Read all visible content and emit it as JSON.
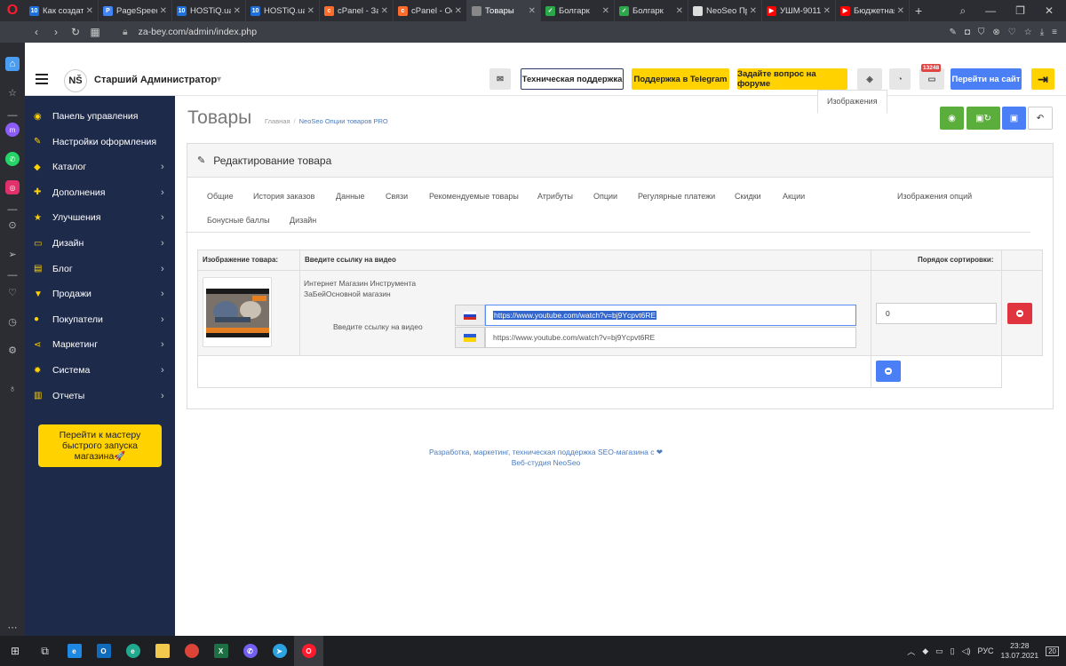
{
  "browser": {
    "tabs": [
      {
        "title": "Как создать",
        "color": "#1e6fd9",
        "glyph": "10"
      },
      {
        "title": "PageSpeed I",
        "color": "#4285f4",
        "glyph": "P"
      },
      {
        "title": "HOSTiQ.ua",
        "color": "#1e6fd9",
        "glyph": "10"
      },
      {
        "title": "HOSTiQ.ua",
        "color": "#1e6fd9",
        "glyph": "10"
      },
      {
        "title": "cPanel - Зад",
        "color": "#ff6c2c",
        "glyph": "c"
      },
      {
        "title": "cPanel - Ос",
        "color": "#ff6c2c",
        "glyph": "c"
      },
      {
        "title": "Товары",
        "color": "#888888",
        "glyph": ""
      },
      {
        "title": "Болгарк",
        "color": "#2aa84a",
        "glyph": "✓"
      },
      {
        "title": "Болгарк",
        "color": "#2aa84a",
        "glyph": "✓"
      },
      {
        "title": "NeoSeo Пр",
        "color": "#dddddd",
        "glyph": ""
      },
      {
        "title": "УШМ-9011",
        "color": "#ff0000",
        "glyph": "▶"
      },
      {
        "title": "Бюджетная",
        "color": "#ff0000",
        "glyph": "▶"
      }
    ],
    "active_tab": 6,
    "url": "za-bey.com/admin/index.php"
  },
  "header": {
    "logo": "NŠ",
    "admin_name": "Старший Администратор",
    "support_label": "Техническая поддержка",
    "telegram_label": "Поддержка в Telegram",
    "forum_label": "Задайте вопрос на форуме",
    "notif_count": "13248",
    "site_label": "Перейти на сайт"
  },
  "sidebar": {
    "items": [
      {
        "label": "Панель управления",
        "icon": "dashboard-icon",
        "glyph": "◉",
        "arrow": false
      },
      {
        "label": "Настройки оформления",
        "icon": "magic-wand-icon",
        "glyph": "✎",
        "arrow": false
      },
      {
        "label": "Каталог",
        "icon": "tag-icon",
        "glyph": "◆",
        "arrow": true
      },
      {
        "label": "Дополнения",
        "icon": "puzzle-icon",
        "glyph": "✚",
        "arrow": true
      },
      {
        "label": "Улучшения",
        "icon": "star-icon",
        "glyph": "★",
        "arrow": true
      },
      {
        "label": "Дизайн",
        "icon": "monitor-icon",
        "glyph": "▭",
        "arrow": true
      },
      {
        "label": "Блог",
        "icon": "document-icon",
        "glyph": "▤",
        "arrow": true
      },
      {
        "label": "Продажи",
        "icon": "cart-icon",
        "glyph": "▼",
        "arrow": true
      },
      {
        "label": "Покупатели",
        "icon": "user-icon",
        "glyph": "●",
        "arrow": true
      },
      {
        "label": "Маркетинг",
        "icon": "share-icon",
        "glyph": "⋖",
        "arrow": true
      },
      {
        "label": "Система",
        "icon": "gear-icon",
        "glyph": "✹",
        "arrow": true
      },
      {
        "label": "Отчеты",
        "icon": "bar-chart-icon",
        "glyph": "▥",
        "arrow": true
      }
    ],
    "wizard_label": "Перейти к мастеру быстрого запуска магазина🚀"
  },
  "page": {
    "title": "Товары",
    "breadcrumb_home": "Главная",
    "breadcrumb_sep": "/",
    "breadcrumb_current": "NeoSeo Опции товаров PRO",
    "panel_title": "Редактирование товара",
    "tabs": [
      "Общие",
      "История заказов",
      "Данные",
      "Связи",
      "Рекомендуемые товары",
      "Атрибуты",
      "Опции",
      "Регулярные платежи",
      "Скидки",
      "Акции",
      "Изображения",
      "Изображения опций",
      "Бонусные баллы",
      "Дизайн"
    ],
    "active_tab": "Изображения"
  },
  "images_table": {
    "col_image": "Изображение товара:",
    "col_video": "Введите ссылку на видео",
    "col_sort": "Порядок сортировки:",
    "row": {
      "store_text_line1": "Интернет Магазин Инструмента",
      "store_text_line2": "ЗаБейОсновной магазин",
      "video_label": "Введите ссылку на видео",
      "video_ru": "https://www.youtube.com/watch?v=bj9Ycpvt6RE",
      "video_ua": "https://www.youtube.com/watch?v=bj9Ycpvt6RE",
      "sort_order": "0"
    }
  },
  "footer": {
    "line1": "Разработка, маркетинг, техническая поддержка SEO-магазина с ❤",
    "line2": "Веб-студия NeoSeo"
  },
  "taskbar": {
    "lang": "РУС",
    "time": "23:28",
    "date": "13.07.2021",
    "notif": "20"
  }
}
